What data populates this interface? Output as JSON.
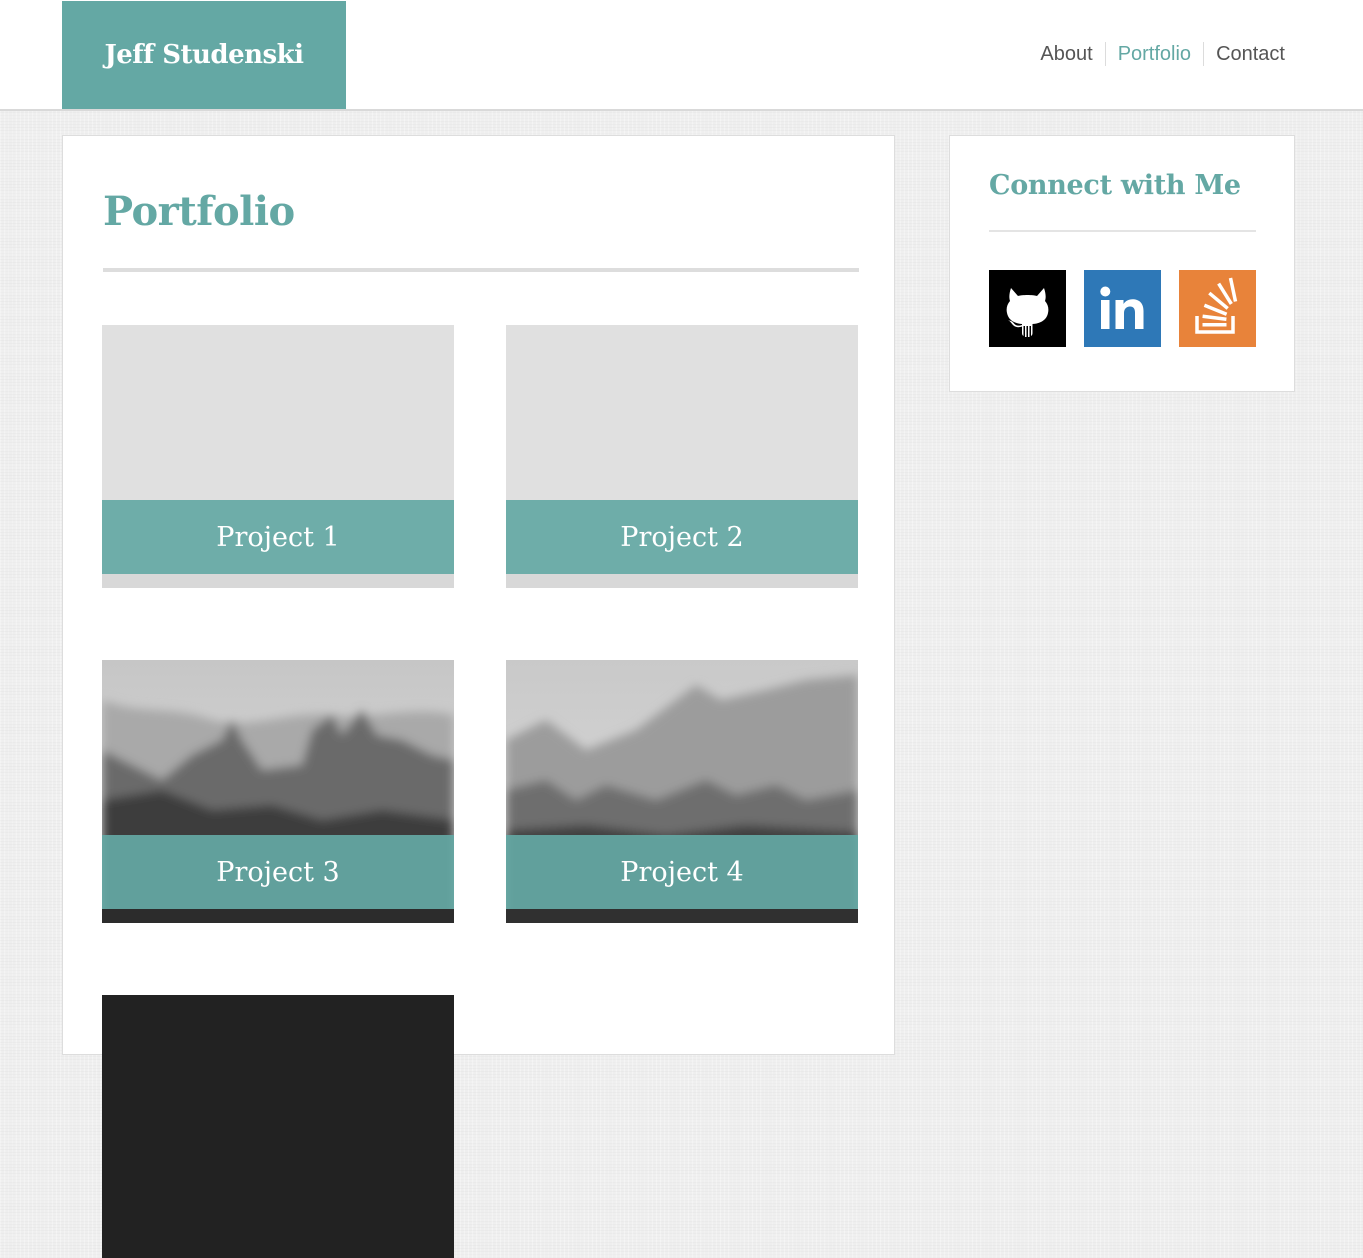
{
  "header": {
    "site_title": "Jeff Studenski",
    "nav": [
      {
        "label": "About",
        "active": false
      },
      {
        "label": "Portfolio",
        "active": true
      },
      {
        "label": "Contact",
        "active": false
      }
    ]
  },
  "main": {
    "page_title": "Portfolio",
    "projects": [
      {
        "label": "Project 1",
        "thumbnail": "blank-placeholder"
      },
      {
        "label": "Project 2",
        "thumbnail": "blank-placeholder"
      },
      {
        "label": "Project 3",
        "thumbnail": "blurred-mountain-landscape"
      },
      {
        "label": "Project 4",
        "thumbnail": "blurred-mountain-landscape"
      },
      {
        "label": "",
        "thumbnail": "dark-placeholder"
      }
    ]
  },
  "sidebar": {
    "title": "Connect with Me",
    "social": [
      {
        "name": "github-icon",
        "color": "#000000"
      },
      {
        "name": "linkedin-icon",
        "color": "#2e78b7"
      },
      {
        "name": "stackoverflow-icon",
        "color": "#e8833a"
      }
    ]
  },
  "colors": {
    "accent": "#64a8a4",
    "background": "#efefef",
    "nav_text": "#555555"
  }
}
